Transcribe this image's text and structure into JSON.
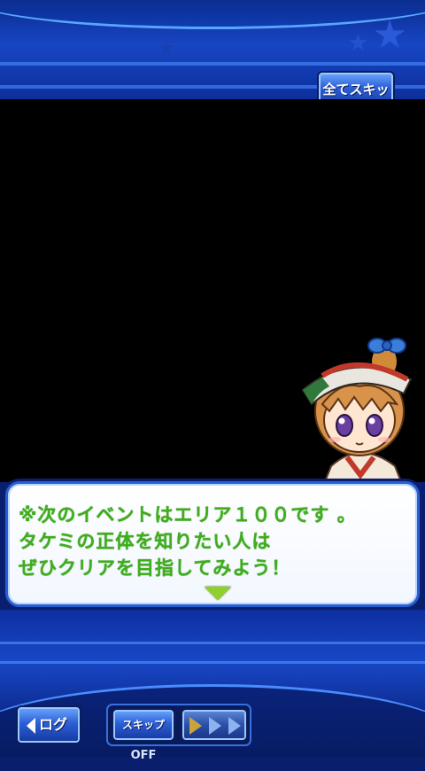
{
  "header": {
    "skip_all_label": "全てスキップ"
  },
  "dialog": {
    "lines": [
      "※次のイベントはエリア１００です 。",
      "タケミの正体を知りたい人は",
      "ぜひクリアを目指してみよう！"
    ]
  },
  "footer": {
    "log_label": "ログ",
    "skip_label": "スキップ",
    "skip_state": "OFF"
  },
  "icons": {
    "log_button_icon": "back-triangle-icon",
    "fast_forward_icon": "fast-forward-icon",
    "dialog_next_icon": "down-triangle-icon",
    "decor": "star-icon"
  }
}
